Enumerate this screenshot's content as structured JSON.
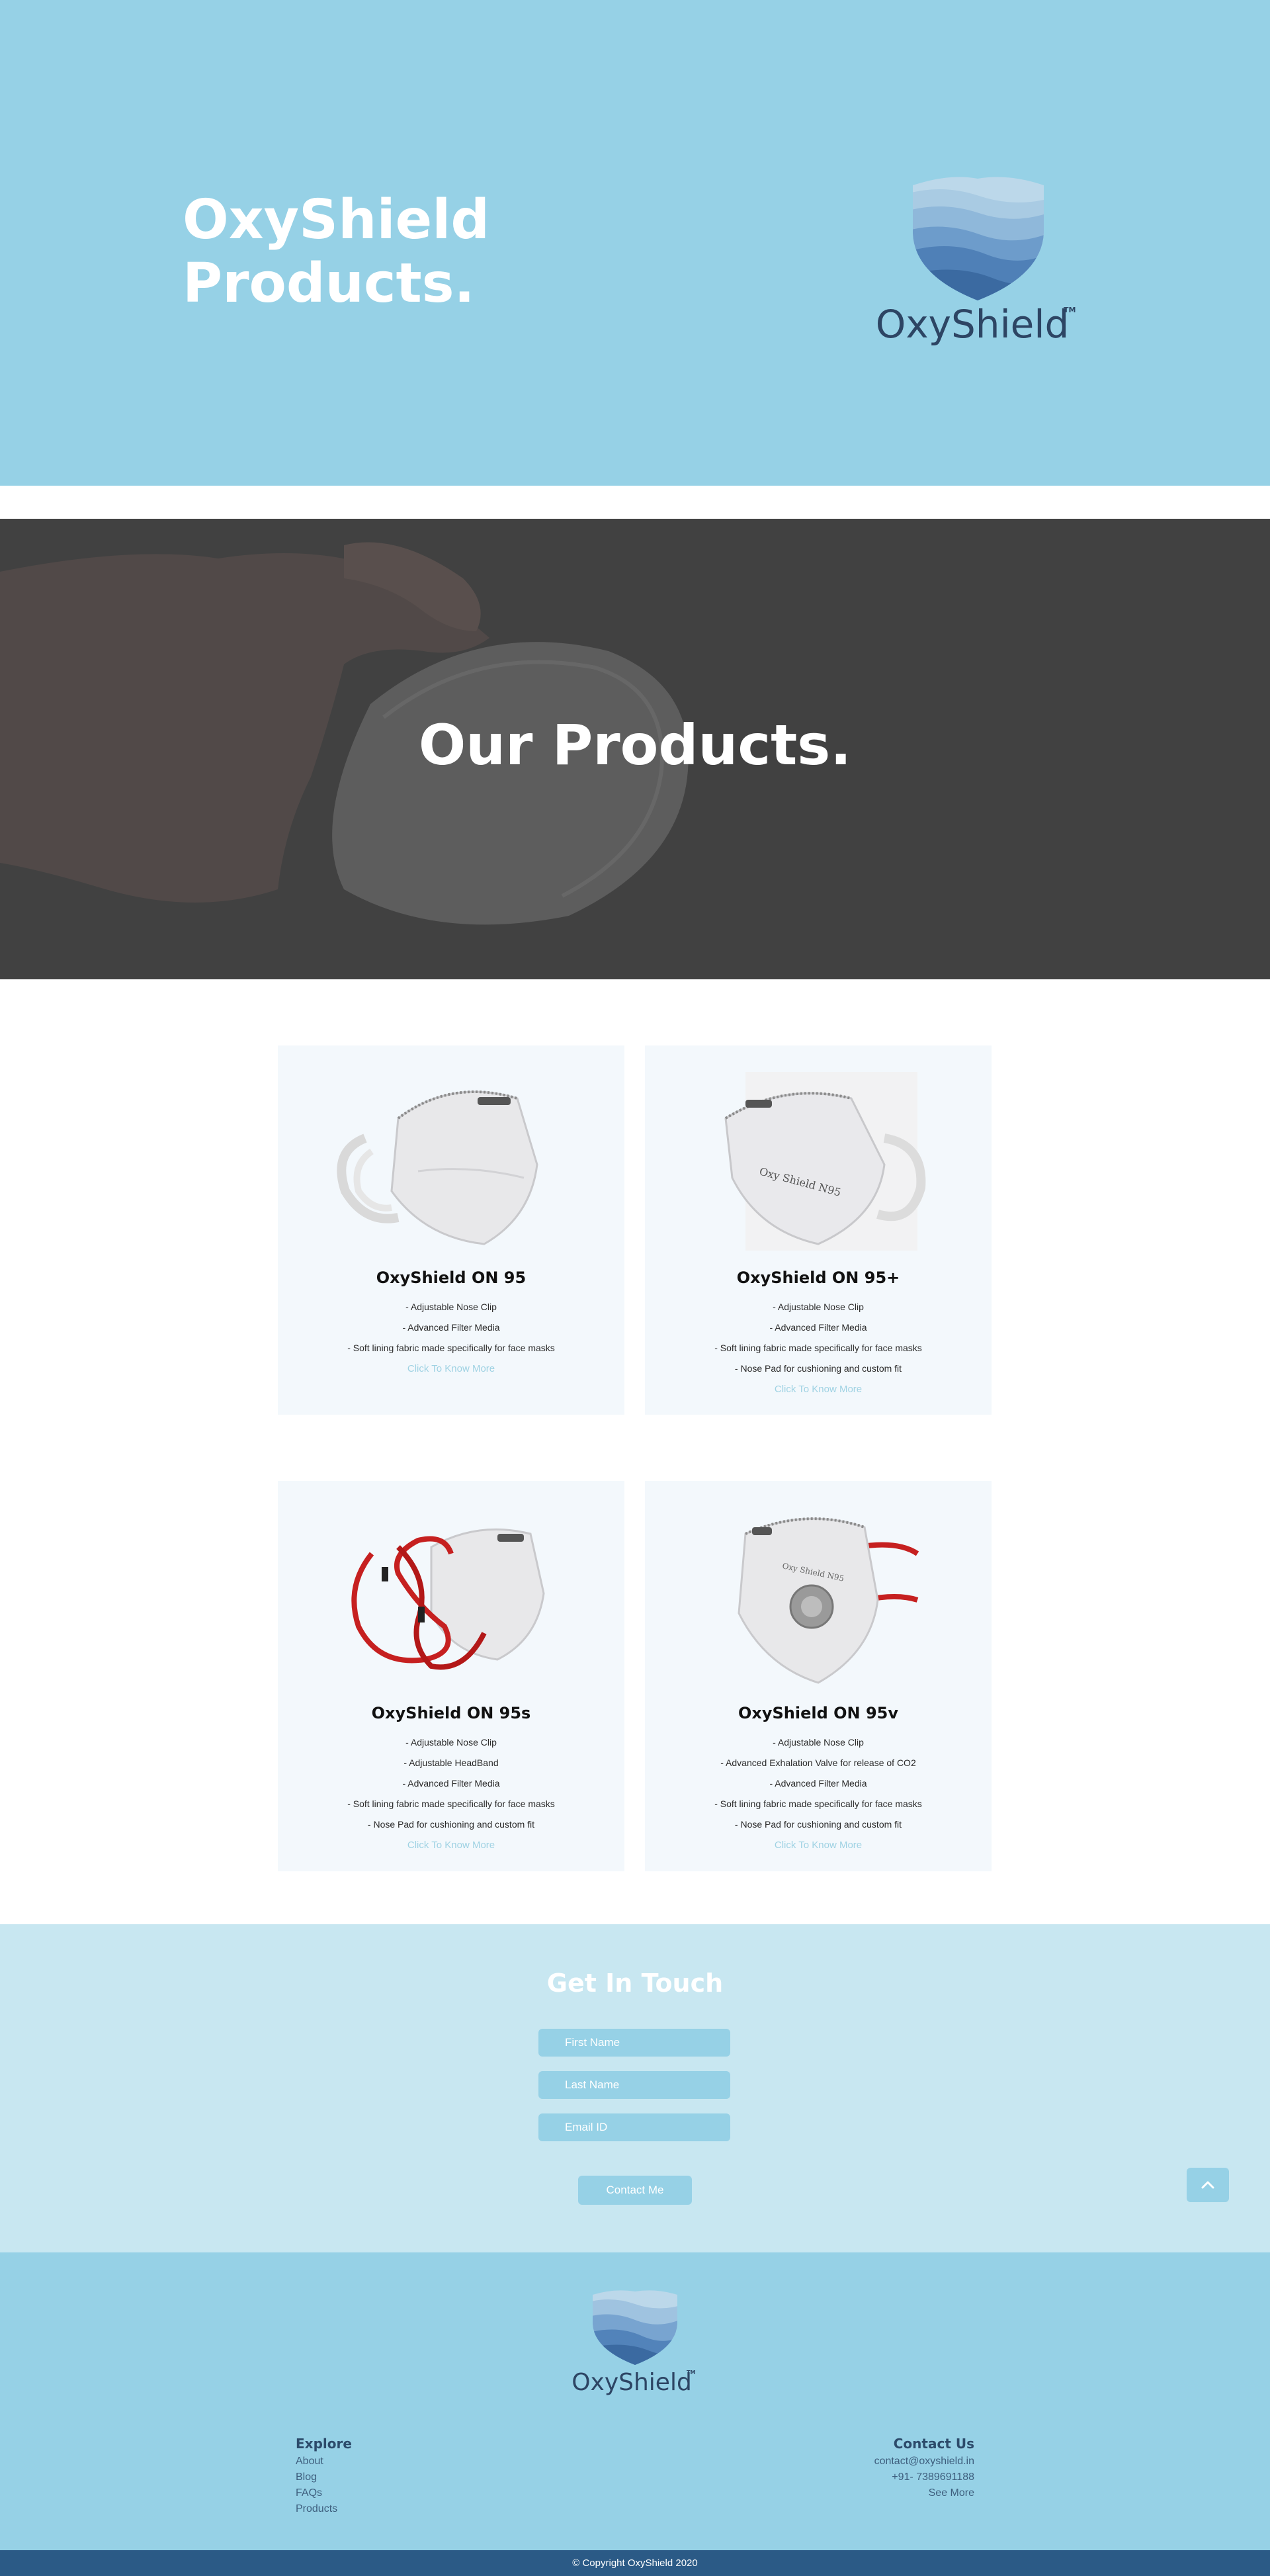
{
  "hero": {
    "title_line1": "OxyShield",
    "title_line2": "Products.",
    "logo_text": "OxyShield",
    "logo_tm": "TM"
  },
  "banner": {
    "title": "Our Products."
  },
  "products": [
    {
      "name_prefix": "OxyShield",
      "name_suffix": "ON 95",
      "features": [
        "- Adjustable Nose Clip",
        "- Advanced Filter Media",
        "- Soft lining fabric made specifically for face masks"
      ],
      "link": "Click To Know More"
    },
    {
      "name_prefix": "OxyShield",
      "name_suffix": "ON 95+",
      "features": [
        "- Adjustable Nose Clip",
        "- Advanced Filter Media",
        "- Soft lining fabric made specifically for face masks",
        "- Nose Pad for cushioning and custom fit"
      ],
      "link": "Click To Know More"
    },
    {
      "name_prefix": "OxyShield",
      "name_suffix": "ON 95s",
      "features": [
        "- Adjustable Nose Clip",
        "- Adjustable HeadBand",
        "- Advanced Filter Media",
        "- Soft lining fabric made specifically for face masks",
        "- Nose Pad for cushioning and custom fit"
      ],
      "link": "Click To Know More"
    },
    {
      "name_prefix": "OxyShield",
      "name_suffix": "ON 95v",
      "features": [
        "- Adjustable Nose Clip",
        "- Advanced Exhalation Valve for release of CO2",
        "- Advanced Filter Media",
        "- Soft lining fabric made specifically for face masks",
        "- Nose Pad for cushioning and custom fit"
      ],
      "link": "Click To Know More"
    }
  ],
  "contact": {
    "title": "Get In Touch",
    "first_name_placeholder": "First Name",
    "last_name_placeholder": "Last Name",
    "email_placeholder": "Email ID",
    "submit_label": "Contact Me",
    "back_to_top_icon": "chevron-up-icon"
  },
  "footer": {
    "logo_text": "OxyShield",
    "logo_tm": "TM",
    "explore_title": "Explore",
    "explore_links": [
      "About",
      "Blog",
      "FAQs",
      "Products"
    ],
    "contact_title": "Contact Us",
    "contact_email": "contact@oxyshield.in",
    "contact_phone": "+91- 7389691188",
    "contact_more": "See More",
    "copyright": "© Copyright OxyShield 2020"
  },
  "colors": {
    "hero_bg": "#96d1e6",
    "contact_bg": "#c8e7f1",
    "footer_bg": "#96d1e6",
    "copyright_bg": "#2b5a86",
    "card_bg": "#f3f8fc",
    "link_color": "#9fd2e3",
    "logo_text_color": "#2d4564"
  }
}
